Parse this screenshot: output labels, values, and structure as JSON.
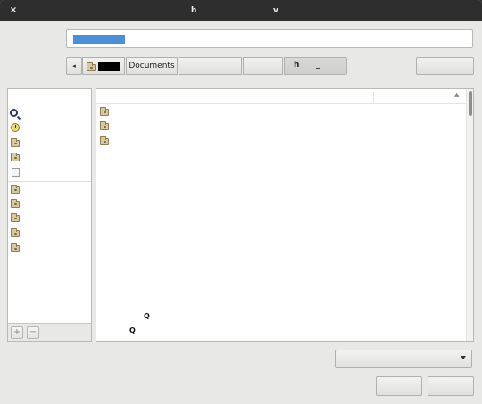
{
  "titlebar": {
    "close_label": "×",
    "title_part1": "h",
    "title_part2": "v"
  },
  "name_entry": {
    "value": ""
  },
  "pathbar": {
    "back_label": "◂",
    "documents_label": "Documents",
    "current_label_1": "h",
    "current_label_2": "_"
  },
  "sidebar": {
    "items": [
      {
        "icon": "search-icon",
        "label": ""
      },
      {
        "icon": "recent-icon",
        "label": ""
      },
      {
        "icon": "folder-icon",
        "label": ""
      },
      {
        "icon": "folder-icon",
        "label": ""
      },
      {
        "icon": "document-icon",
        "label": ""
      },
      {
        "icon": "folder-icon",
        "label": ""
      },
      {
        "icon": "folder-icon",
        "label": ""
      },
      {
        "icon": "folder-icon",
        "label": ""
      },
      {
        "icon": "folder-icon",
        "label": ""
      },
      {
        "icon": "folder-icon",
        "label": ""
      }
    ],
    "add_label": "+",
    "remove_label": "−"
  },
  "filelist": {
    "sort_indicator": "▲",
    "rows": [
      {
        "icon": "folder-icon",
        "name": ""
      },
      {
        "icon": "folder-icon",
        "name": ""
      },
      {
        "icon": "folder-icon",
        "name": ""
      }
    ],
    "stray_1": "Q",
    "stray_2": "Q"
  },
  "filter": {
    "value": ""
  },
  "buttons": {
    "cancel_label": "",
    "ok_label": ""
  }
}
